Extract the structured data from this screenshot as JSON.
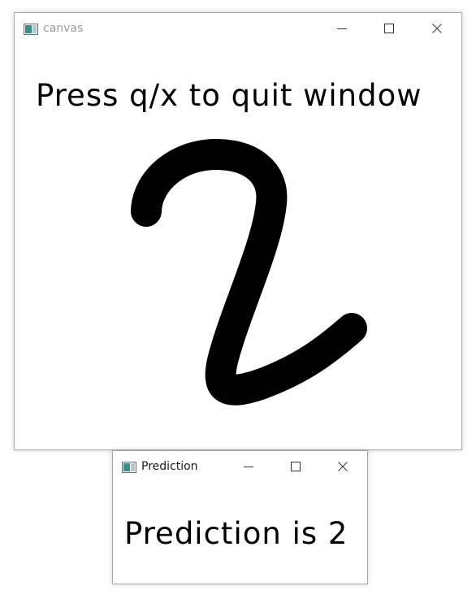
{
  "canvas_window": {
    "title": "canvas",
    "instruction_text": "Press q/x to quit window",
    "drawn_digit": "2"
  },
  "prediction_window": {
    "title": "Prediction",
    "result_text": "Prediction is 2"
  },
  "colors": {
    "title_inactive": "#9a9a9a",
    "title_active": "#1a1a1a",
    "window_border": "#a9a9a9",
    "ink": "#000000",
    "background": "#ffffff"
  },
  "icons": {
    "app": "app-window-icon",
    "minimize": "minimize-icon",
    "maximize": "maximize-icon",
    "close": "close-icon"
  }
}
